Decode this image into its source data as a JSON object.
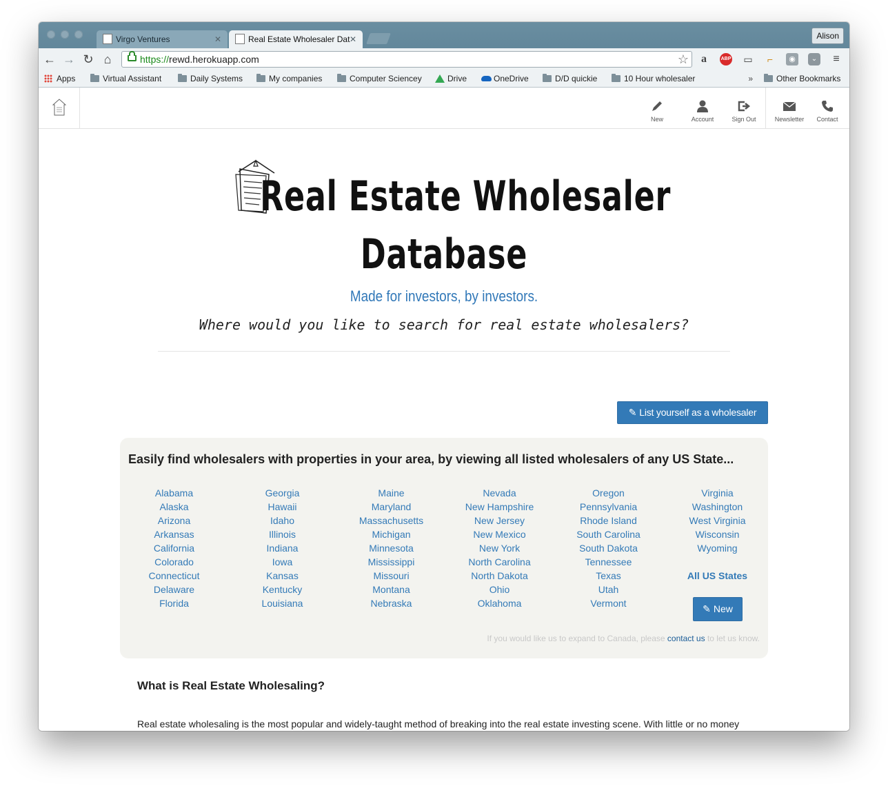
{
  "browser": {
    "tabs": [
      {
        "title": "Virgo Ventures",
        "active": false
      },
      {
        "title": "Real Estate Wholesaler Dat",
        "active": true
      }
    ],
    "profile": "Alison",
    "url_scheme": "https://",
    "url_host": "rewd.herokuapp.com",
    "extensions": [
      "amazon-icon",
      "adblock-plus-icon",
      "cast-icon",
      "ruler-icon",
      "camera-icon",
      "pocket-icon",
      "menu-icon"
    ],
    "adblock_label": "ABP",
    "bookmarks": [
      {
        "label": "Apps",
        "icon": "apps-icon"
      },
      {
        "label": "Virtual Assistant",
        "icon": "folder-icon"
      },
      {
        "label": "Daily Systems",
        "icon": "folder-icon"
      },
      {
        "label": "My companies",
        "icon": "folder-icon"
      },
      {
        "label": "Computer Sciencey",
        "icon": "folder-icon"
      },
      {
        "label": "Drive",
        "icon": "drive-icon"
      },
      {
        "label": "OneDrive",
        "icon": "onedrive-icon"
      },
      {
        "label": "D/D quickie",
        "icon": "folder-icon"
      },
      {
        "label": "10 Hour wholesaler",
        "icon": "folder-icon"
      }
    ],
    "bookmarks_overflow": "»",
    "other_bookmarks": "Other Bookmarks"
  },
  "nav": {
    "items": [
      {
        "label": "New",
        "icon": "pencil-icon"
      },
      {
        "label": "Account",
        "icon": "user-icon"
      },
      {
        "label": "Sign Out",
        "icon": "sign-out-icon"
      },
      {
        "label": "Newsletter",
        "icon": "envelope-icon"
      },
      {
        "label": "Contact",
        "icon": "phone-icon"
      }
    ]
  },
  "hero": {
    "title_line1": "Real Estate Wholesaler",
    "title_line2": "Database",
    "tagline": "Made for investors, by investors.",
    "question": "Where would you like to search for real estate wholesalers?"
  },
  "list_button": "List yourself as a wholesaler",
  "panel": {
    "heading": "Easily find wholesalers with properties in your area, by viewing all listed wholesalers of any US State...",
    "columns": [
      [
        "Alabama",
        "Alaska",
        "Arizona",
        "Arkansas",
        "California",
        "Colorado",
        "Connecticut",
        "Delaware",
        "Florida"
      ],
      [
        "Georgia",
        "Hawaii",
        "Idaho",
        "Illinois",
        "Indiana",
        "Iowa",
        "Kansas",
        "Kentucky",
        "Louisiana"
      ],
      [
        "Maine",
        "Maryland",
        "Massachusetts",
        "Michigan",
        "Minnesota",
        "Mississippi",
        "Missouri",
        "Montana",
        "Nebraska"
      ],
      [
        "Nevada",
        "New Hampshire",
        "New Jersey",
        "New Mexico",
        "New York",
        "North Carolina",
        "North Dakota",
        "Ohio",
        "Oklahoma"
      ],
      [
        "Oregon",
        "Pennsylvania",
        "Rhode Island",
        "South Carolina",
        "South Dakota",
        "Tennessee",
        "Texas",
        "Utah",
        "Vermont"
      ],
      [
        "Virginia",
        "Washington",
        "West Virginia",
        "Wisconsin",
        "Wyoming"
      ]
    ],
    "all_states": "All US States",
    "new_button": "New",
    "canada_prefix": "If you would like us to expand to Canada, please",
    "canada_link": "contact us",
    "canada_suffix": "to let us know."
  },
  "about": {
    "heading": "What is Real Estate Wholesaling?",
    "text": "Real estate wholesaling is the most popular and widely-taught method of breaking into the real estate investing scene. With little or no money"
  }
}
